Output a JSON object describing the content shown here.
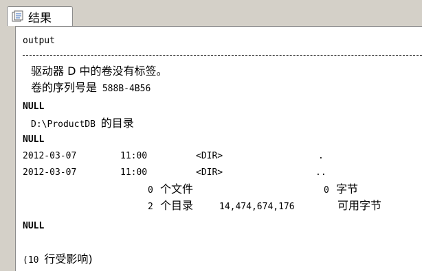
{
  "tab": {
    "label": "结果",
    "icon": "results-grid-icon"
  },
  "output": {
    "header": "output",
    "line_volume": "驱动器 D 中的卷没有标签。",
    "line_serial_prefix": "卷的序列号是",
    "line_serial_value": "588B-4B56",
    "null1": "NULL",
    "dir_path": "D:\\ProductDB",
    "dir_suffix": "的目录",
    "null2": "NULL",
    "row1": {
      "date": "2012-03-07",
      "time": "11:00",
      "type": "<DIR>",
      "name": "."
    },
    "row2": {
      "date": "2012-03-07",
      "time": "11:00",
      "type": "<DIR>",
      "name": ".."
    },
    "files_count": "0",
    "files_label": "个文件",
    "files_bytes": "0",
    "bytes_label": "字节",
    "dirs_count": "2",
    "dirs_label": "个目录",
    "free_bytes": "14,474,674,176",
    "free_label": "可用字节",
    "null3": "NULL",
    "rows_affected_prefix": "(10",
    "rows_affected_label": "行受影响)"
  }
}
